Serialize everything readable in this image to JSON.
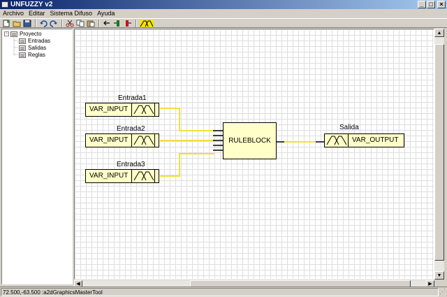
{
  "window": {
    "title": "UNFUZZY v2",
    "controls": [
      "_",
      "□",
      "×"
    ]
  },
  "menu": [
    "Archivo",
    "Editar",
    "Sistema Difuso",
    "Ayuda"
  ],
  "toolbar": {
    "icons": [
      "new-icon",
      "open-icon",
      "save-icon",
      "undo-icon",
      "redo-icon",
      "cut-icon",
      "copy-icon",
      "paste-icon",
      "back-arrow-icon",
      "add-input-icon",
      "add-output-icon",
      "membership-icon"
    ]
  },
  "tree": {
    "root": "Proyecto",
    "children": [
      "Entradas",
      "Salidas",
      "Reglas"
    ]
  },
  "diagram": {
    "inputs": [
      {
        "name": "Entrada1",
        "type": "VAR_INPUT"
      },
      {
        "name": "Entrada2",
        "type": "VAR_INPUT"
      },
      {
        "name": "Entrada3",
        "type": "VAR_INPUT"
      }
    ],
    "rule_block": "RULEBLOCK",
    "output": {
      "name": "Salida",
      "type": "VAR_OUTPUT"
    },
    "wire_color": "#f0e040"
  },
  "status": {
    "text": "72.500,-63.500 :a2dGraphicsMasterTool"
  }
}
